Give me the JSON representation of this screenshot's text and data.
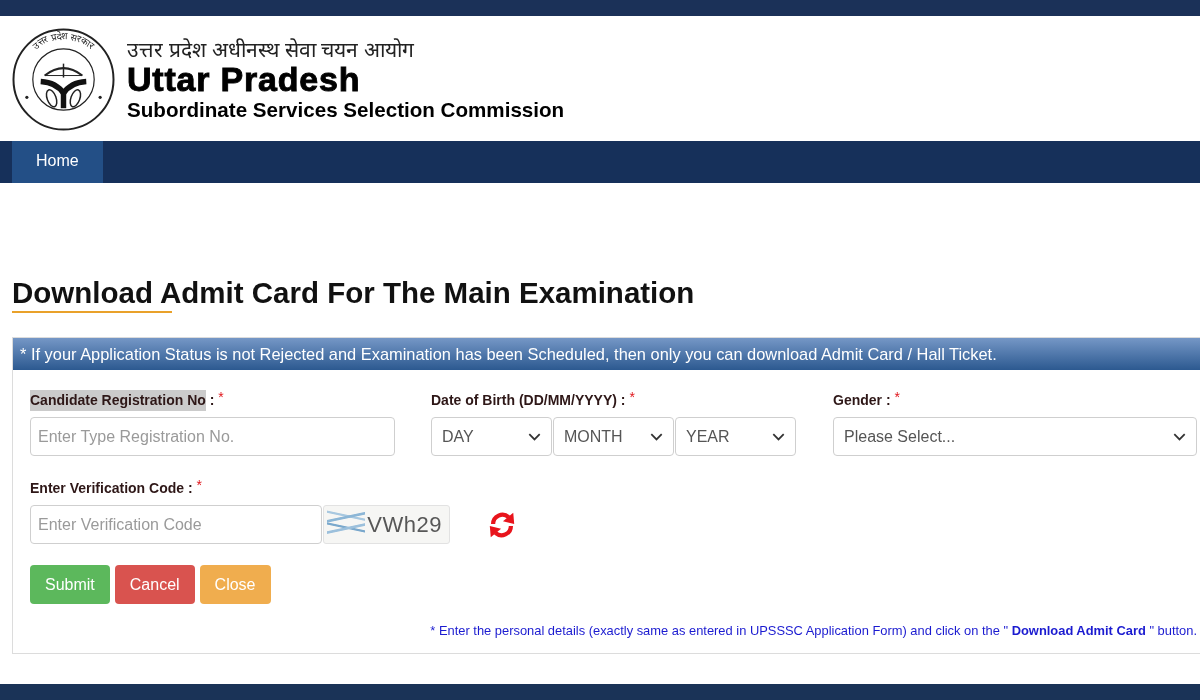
{
  "header": {
    "emblem_text": "उत्तर प्रदेश सरकार",
    "hindi_title": "उत्तर प्रदेश अधीनस्थ सेवा चयन आयोग",
    "title": "Uttar Pradesh",
    "subtitle": "Subordinate Services Selection Commission"
  },
  "nav": {
    "items": [
      {
        "label": "Home",
        "selected": true
      }
    ]
  },
  "page_title": "Download Admit Card For The Main Examination",
  "form": {
    "notice": "* If your Application Status is not Rejected and Examination has been Scheduled, then only you can download Admit Card / Hall Ticket.",
    "fields": [
      {
        "kind": "text",
        "label": "Candidate Registration No",
        "separator": ":",
        "required_mark": "*",
        "highlighted": true,
        "placeholder": "Enter Type Registration No."
      },
      {
        "kind": "date",
        "label": "Date of Birth (DD/MM/YYYY)",
        "separator": ":",
        "required_mark": "*",
        "highlighted": false,
        "selects": [
          "DAY",
          "MONTH",
          "YEAR"
        ]
      },
      {
        "kind": "select",
        "label": "Gender",
        "separator": ":",
        "required_mark": "*",
        "highlighted": false,
        "value": "Please Select..."
      },
      {
        "kind": "captcha",
        "label": "Enter Verification Code",
        "separator": ":",
        "required_mark": "*",
        "highlighted": false,
        "placeholder": "Enter Verification Code",
        "captcha": "VWh29"
      }
    ],
    "buttons": [
      {
        "label": "Submit",
        "kind": "success"
      },
      {
        "label": "Cancel",
        "kind": "danger"
      },
      {
        "label": "Close",
        "kind": "warning"
      }
    ],
    "footnote": "* Enter the personal details (exactly same as entered in UPSSSC Application Form) and click on the \" **Download Admit Card** \" button."
  }
}
